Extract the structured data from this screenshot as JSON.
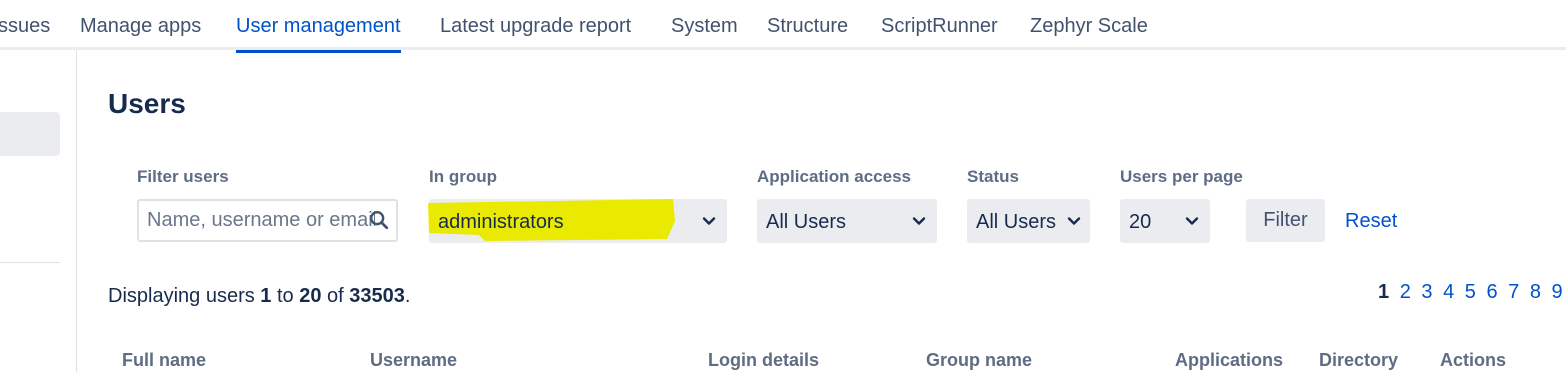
{
  "nav": {
    "tabs": [
      {
        "label": "ssues"
      },
      {
        "label": "Manage apps"
      },
      {
        "label": "User management",
        "active": true
      },
      {
        "label": "Latest upgrade report"
      },
      {
        "label": "System"
      },
      {
        "label": "Structure"
      },
      {
        "label": "ScriptRunner"
      },
      {
        "label": "Zephyr Scale"
      }
    ]
  },
  "page": {
    "title": "Users"
  },
  "filters": {
    "filter_users": {
      "label": "Filter users",
      "placeholder": "Name, username or email",
      "value": ""
    },
    "in_group": {
      "label": "In group",
      "value": "administrators"
    },
    "application_access": {
      "label": "Application access",
      "value": "All Users"
    },
    "status": {
      "label": "Status",
      "value": "All Users"
    },
    "users_per_page": {
      "label": "Users per page",
      "value": "20"
    },
    "filter_button": "Filter",
    "reset_link": "Reset"
  },
  "summary": {
    "prefix": "Displaying users ",
    "from": "1",
    "to_word": " to ",
    "to": "20",
    "of_word": " of ",
    "total": "33503",
    "suffix": "."
  },
  "pagination": {
    "pages": [
      "1",
      "2",
      "3",
      "4",
      "5",
      "6",
      "7",
      "8",
      "9"
    ],
    "current": "1",
    "next_icon": "triangle-right-icon"
  },
  "table": {
    "columns": [
      "Full name",
      "Username",
      "Login details",
      "Group name",
      "Applications",
      "Directory",
      "Actions"
    ]
  },
  "colors": {
    "accent": "#0052cc",
    "highlight": "#eaea00",
    "control_bg": "#ebecf0",
    "text": "#172b4d"
  }
}
